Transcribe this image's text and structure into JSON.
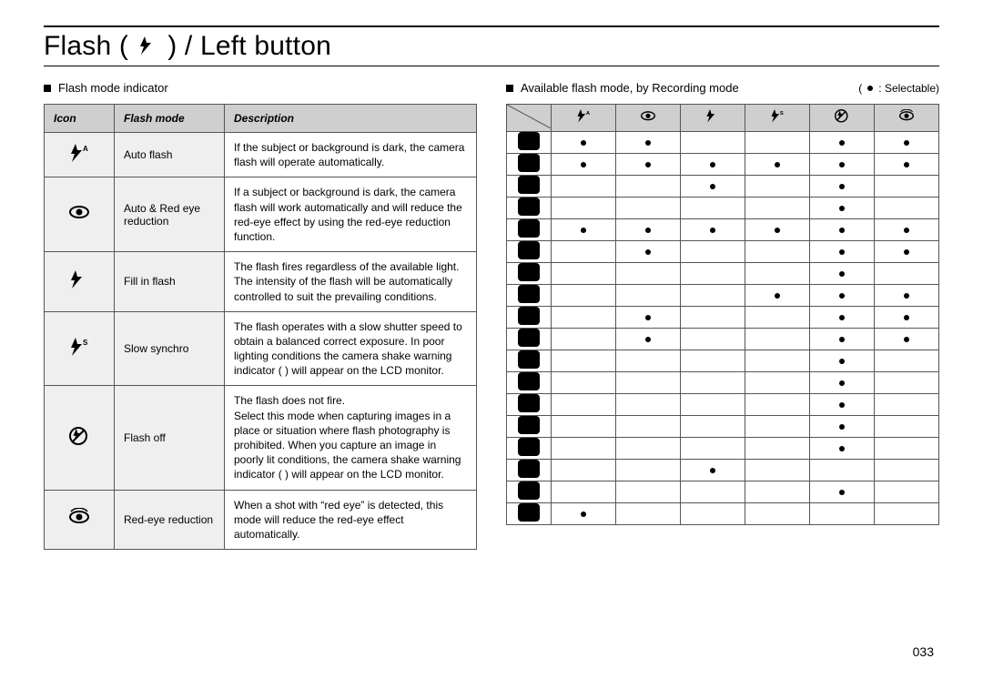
{
  "title_prefix": "Flash (",
  "title_suffix": ") / Left button",
  "page_number": "033",
  "left": {
    "section_label": "Flash mode indicator",
    "headers": {
      "icon": "Icon",
      "mode": "Flash mode",
      "desc": "Description"
    },
    "rows": [
      {
        "icon": "flash-auto",
        "mode": "Auto flash",
        "desc": "If the subject or background is dark, the camera flash will operate automatically."
      },
      {
        "icon": "eye",
        "mode": "Auto & Red eye reduction",
        "desc": "If a subject or background is dark, the camera flash will work automatically and will reduce the red-eye effect by using the red-eye reduction function."
      },
      {
        "icon": "flash",
        "mode": "Fill in flash",
        "desc": "The flash fires regardless of the available light. The intensity of the flash will be automatically controlled to suit the prevailing conditions."
      },
      {
        "icon": "flash-slow",
        "mode": "Slow synchro",
        "desc": "The flash operates with a slow shutter speed to obtain a balanced correct exposure. In poor lighting conditions the camera shake warning indicator (  ) will appear on the LCD monitor."
      },
      {
        "icon": "flash-off",
        "mode": "Flash off",
        "desc": "The flash does not fire.\nSelect this mode when capturing images in a place or situation where flash photography is prohibited. When you capture an image in poorly lit conditions, the camera shake warning indicator (  ) will appear on the LCD monitor."
      },
      {
        "icon": "redeye-fix",
        "mode": "Red-eye reduction",
        "desc": "When a shot with “red eye” is detected, this mode will reduce the red-eye effect automatically."
      }
    ]
  },
  "right": {
    "section_label": "Available flash mode, by Recording mode",
    "legend_prefix": "(",
    "legend_label": ": Selectable)",
    "col_icons": [
      "flash-auto",
      "eye",
      "flash",
      "flash-slow",
      "flash-off",
      "redeye-fix"
    ],
    "rows": [
      {
        "icon": "rec-auto",
        "cells": [
          1,
          1,
          0,
          0,
          1,
          1
        ]
      },
      {
        "icon": "rec-auto2",
        "cells": [
          1,
          1,
          1,
          1,
          1,
          1
        ]
      },
      {
        "icon": "rec-m",
        "cells": [
          0,
          0,
          1,
          0,
          1,
          0
        ]
      },
      {
        "icon": "rec-dual",
        "cells": [
          0,
          0,
          0,
          0,
          1,
          0
        ]
      },
      {
        "icon": "rec-scene",
        "cells": [
          1,
          1,
          1,
          1,
          1,
          1
        ]
      },
      {
        "icon": "rec-square",
        "cells": [
          0,
          1,
          0,
          0,
          1,
          1
        ]
      },
      {
        "icon": "rec-guide",
        "cells": [
          0,
          0,
          0,
          0,
          1,
          0
        ]
      },
      {
        "icon": "rec-night",
        "cells": [
          0,
          0,
          0,
          1,
          1,
          1
        ]
      },
      {
        "icon": "rec-portrait",
        "cells": [
          0,
          1,
          0,
          0,
          1,
          1
        ]
      },
      {
        "icon": "rec-children",
        "cells": [
          0,
          1,
          0,
          0,
          1,
          1
        ]
      },
      {
        "icon": "rec-landscape",
        "cells": [
          0,
          0,
          0,
          0,
          1,
          0
        ]
      },
      {
        "icon": "rec-text",
        "cells": [
          0,
          0,
          0,
          0,
          1,
          0
        ]
      },
      {
        "icon": "rec-closeup",
        "cells": [
          0,
          0,
          0,
          0,
          1,
          0
        ]
      },
      {
        "icon": "rec-sunset",
        "cells": [
          0,
          0,
          0,
          0,
          1,
          0
        ]
      },
      {
        "icon": "rec-dawn",
        "cells": [
          0,
          0,
          0,
          0,
          1,
          0
        ]
      },
      {
        "icon": "rec-backlight",
        "cells": [
          0,
          0,
          1,
          0,
          0,
          0
        ]
      },
      {
        "icon": "rec-firework",
        "cells": [
          0,
          0,
          0,
          0,
          1,
          0
        ]
      },
      {
        "icon": "rec-beach",
        "cells": [
          1,
          0,
          0,
          0,
          0,
          0
        ]
      }
    ]
  },
  "chart_data": {
    "type": "table",
    "title": "Available flash mode, by Recording mode (●: Selectable)",
    "columns": [
      "Auto flash",
      "Auto & Red eye reduction",
      "Fill in flash",
      "Slow synchro",
      "Flash off",
      "Red-eye reduction"
    ],
    "rows": [
      "rec-auto",
      "rec-auto2",
      "rec-m",
      "rec-dual",
      "rec-scene",
      "rec-square",
      "rec-guide",
      "rec-night",
      "rec-portrait",
      "rec-children",
      "rec-landscape",
      "rec-text",
      "rec-closeup",
      "rec-sunset",
      "rec-dawn",
      "rec-backlight",
      "rec-firework",
      "rec-beach"
    ],
    "values": [
      [
        1,
        1,
        0,
        0,
        1,
        1
      ],
      [
        1,
        1,
        1,
        1,
        1,
        1
      ],
      [
        0,
        0,
        1,
        0,
        1,
        0
      ],
      [
        0,
        0,
        0,
        0,
        1,
        0
      ],
      [
        1,
        1,
        1,
        1,
        1,
        1
      ],
      [
        0,
        1,
        0,
        0,
        1,
        1
      ],
      [
        0,
        0,
        0,
        0,
        1,
        0
      ],
      [
        0,
        0,
        0,
        1,
        1,
        1
      ],
      [
        0,
        1,
        0,
        0,
        1,
        1
      ],
      [
        0,
        1,
        0,
        0,
        1,
        1
      ],
      [
        0,
        0,
        0,
        0,
        1,
        0
      ],
      [
        0,
        0,
        0,
        0,
        1,
        0
      ],
      [
        0,
        0,
        0,
        0,
        1,
        0
      ],
      [
        0,
        0,
        0,
        0,
        1,
        0
      ],
      [
        0,
        0,
        0,
        0,
        1,
        0
      ],
      [
        0,
        0,
        1,
        0,
        0,
        0
      ],
      [
        0,
        0,
        0,
        0,
        1,
        0
      ],
      [
        1,
        0,
        0,
        0,
        0,
        0
      ]
    ]
  }
}
